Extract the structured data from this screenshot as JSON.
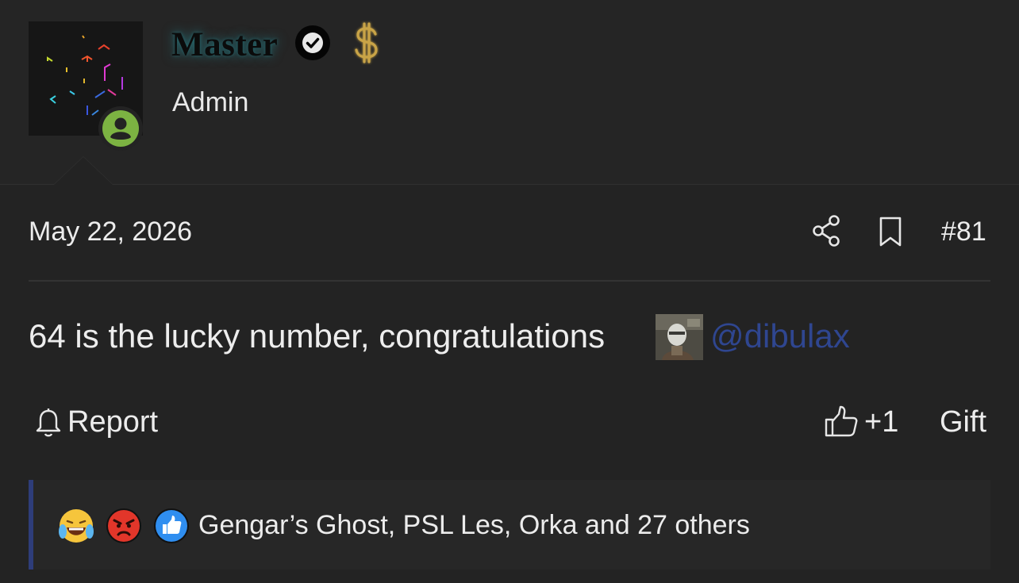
{
  "user": {
    "name": "Master",
    "role": "Admin",
    "verified_icon": "verified-check-icon",
    "badge_icon": "dollar-icon",
    "status": "online",
    "status_color": "#7cb342"
  },
  "post": {
    "date": "May 22, 2026",
    "number": "#81",
    "message": "64 is the lucky number, congratulations",
    "mention": "@dibulax",
    "mention_color": "#2f4690"
  },
  "actions": {
    "report": "Report",
    "like": "+1",
    "gift": "Gift"
  },
  "reactions": {
    "icons": [
      "joy-tears-icon",
      "angry-face-icon",
      "thumbs-up-icon"
    ],
    "summary": "Gengar’s Ghost, PSL Les, Orka and 27 others"
  }
}
